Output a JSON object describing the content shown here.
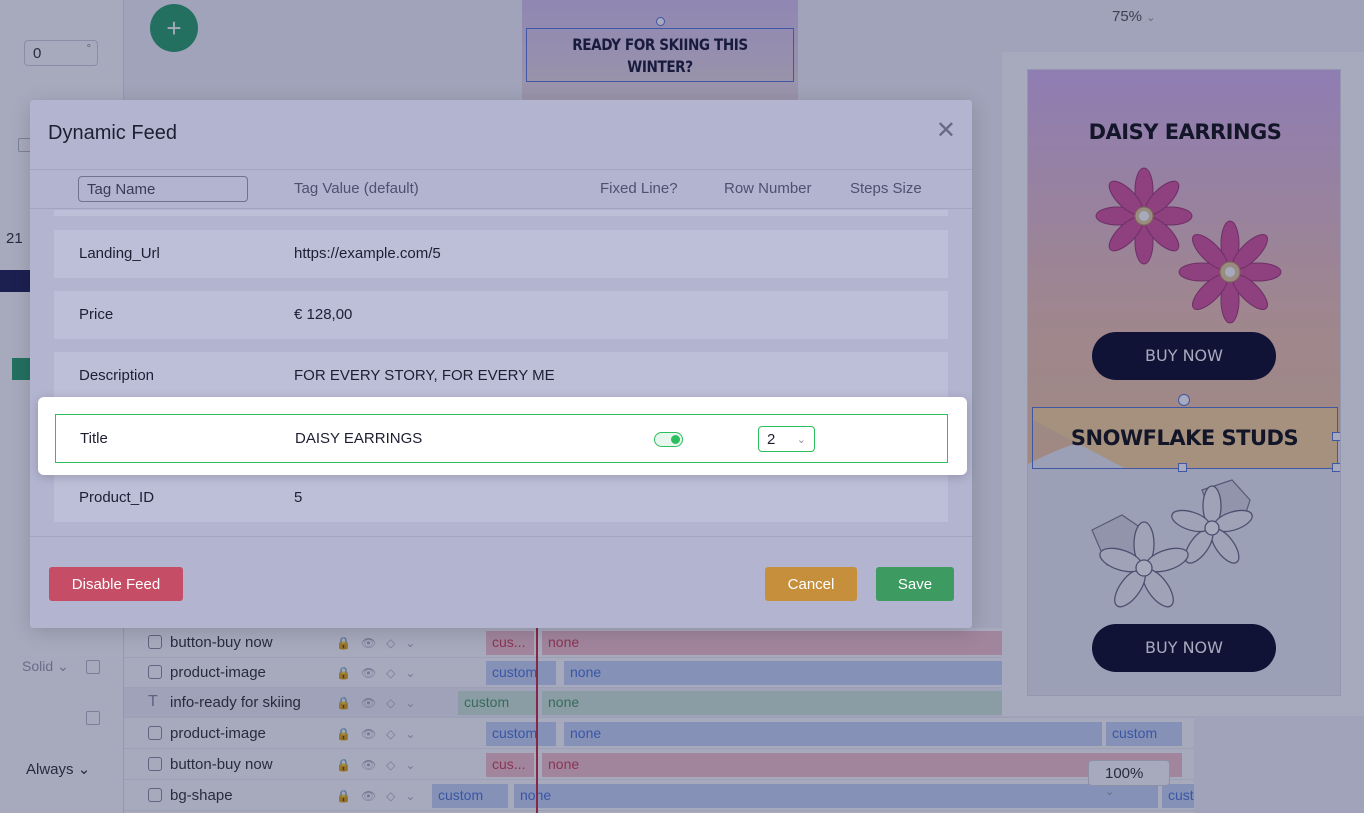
{
  "background": {
    "left_panel": {
      "input_value": "0",
      "input_unit": "°",
      "number": "21",
      "solid_label": "Solid",
      "always_label": "Always"
    },
    "add_button_label": "+",
    "canvas_top_text": "READY FOR SKIING THIS WINTER?",
    "zoom_top": "75%",
    "zoom_bottom": "100%",
    "timeline": [
      {
        "name": "button-buy now",
        "bars": [
          "cus...",
          "none"
        ]
      },
      {
        "name": "product-image",
        "bars": [
          "custom",
          "none"
        ]
      },
      {
        "name": "info-ready for skiing",
        "bars": [
          "custom",
          "none"
        ]
      },
      {
        "name": "product-image",
        "bars": [
          "custom",
          "none",
          "custom"
        ]
      },
      {
        "name": "button-buy now",
        "bars": [
          "cus...",
          "none"
        ]
      },
      {
        "name": "bg-shape",
        "bars": [
          "custom",
          "none",
          "cust"
        ]
      }
    ],
    "preview": {
      "title1": "DAISY EARRINGS",
      "button1": "BUY NOW",
      "title2": "SNOWFLAKE STUDS",
      "button2": "BUY NOW"
    }
  },
  "modal": {
    "title": "Dynamic Feed",
    "close_icon": "close-icon",
    "header": {
      "tag_name_placeholder": "Tag Name",
      "tag_value": "Tag Value (default)",
      "fixed_line": "Fixed Line?",
      "row_number": "Row Number",
      "steps_size": "Steps Size"
    },
    "rows": [
      {
        "name": "Landing_Url",
        "value": "https://example.com/5"
      },
      {
        "name": "Price",
        "value": "€ 128,00"
      },
      {
        "name": "Description",
        "value": "FOR EVERY STORY, FOR EVERY ME"
      },
      {
        "name": "Title",
        "value": "DAISY EARRINGS",
        "fixed_line": true,
        "row_number": "2"
      },
      {
        "name": "Product_ID",
        "value": "5"
      }
    ],
    "buttons": {
      "disable": "Disable Feed",
      "cancel": "Cancel",
      "save": "Save"
    }
  }
}
